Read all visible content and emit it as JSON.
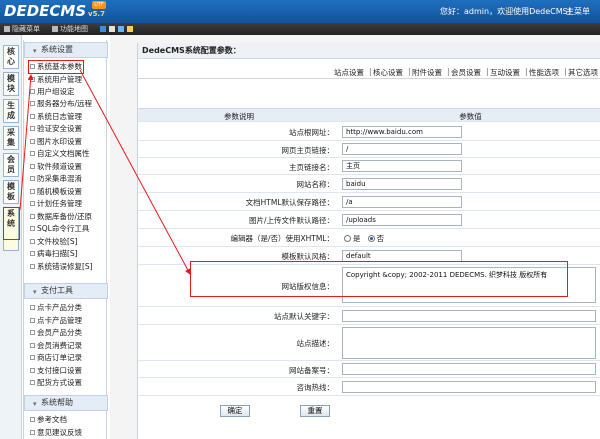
{
  "header": {
    "logo_text": "DEDECMS",
    "version": "v5.7",
    "badge": "UTF",
    "welcome": "您好：admin，欢迎使用DedeCMS!",
    "home": "主菜单"
  },
  "subbar": {
    "hide_menu": "隐藏菜单",
    "func_map": "功能地图",
    "swatches": [
      "#3a8ee6",
      "#e2e2e2",
      "#66b3ff",
      "#ffcc55"
    ]
  },
  "vtabs": [
    "核心",
    "模块",
    "生成",
    "采集",
    "会员",
    "模板",
    "系统"
  ],
  "menu": {
    "sections": [
      {
        "title": "系统设置",
        "items": [
          "系统基本参数",
          "系统用户管理",
          "用户组设定",
          "服务器分布/远程",
          "系统日志管理",
          "验证安全设置",
          "图片水印设置",
          "自定义文档属性",
          "软件频道设置",
          "防采集串混淆",
          "随机模板设置",
          "计划任务管理",
          "数据库备份/还原",
          "SQL命令行工具",
          "文件校验[S]",
          "病毒扫描[S]",
          "系统错误修复[S]"
        ]
      },
      {
        "title": "支付工具",
        "items": [
          "点卡产品分类",
          "点卡产品管理",
          "会员产品分类",
          "会员消费记录",
          "商店订单记录",
          "支付接口设置",
          "配货方式设置"
        ]
      },
      {
        "title": "系统帮助",
        "items": [
          "参考文档",
          "意见建议反馈"
        ]
      }
    ]
  },
  "main": {
    "panel_title": "DedeCMS系统配置参数：",
    "tabs": [
      "站点设置",
      "核心设置",
      "附件设置",
      "会员设置",
      "互动设置",
      "性能选项",
      "其它选项"
    ],
    "table_header": {
      "label": "参数说明",
      "value": "参数值"
    },
    "rows": [
      {
        "label": "站点根网址：",
        "value": "http://www.baidu.com"
      },
      {
        "label": "网页主页链接：",
        "value": "/"
      },
      {
        "label": "主页链接名：",
        "value": "主页"
      },
      {
        "label": "网站名称：",
        "value": "baidu"
      },
      {
        "label": "文档HTML默认保存路径：",
        "value": "/a"
      },
      {
        "label": "图片/上传文件默认路径：",
        "value": "/uploads"
      },
      {
        "label": "编辑器（是/否）使用XHTML：",
        "radio_yes": "是",
        "radio_no": "否",
        "selected": "否"
      },
      {
        "label": "模板默认风格：",
        "value": "default"
      },
      {
        "label": "网站版权信息：",
        "value": "Copyright &copy; 2002-2011 DEDECMS. 织梦科技 版权所有"
      },
      {
        "label": "站点默认关键字：",
        "value": ""
      },
      {
        "label": "站点描述：",
        "value": ""
      },
      {
        "label": "网站备案号：",
        "value": ""
      },
      {
        "label": "咨询热线：",
        "value": ""
      }
    ],
    "buttons": {
      "ok": "确定",
      "reset": "重置"
    }
  },
  "colors": {
    "header": "#1a62b0",
    "annotation": "#e41b1b"
  }
}
